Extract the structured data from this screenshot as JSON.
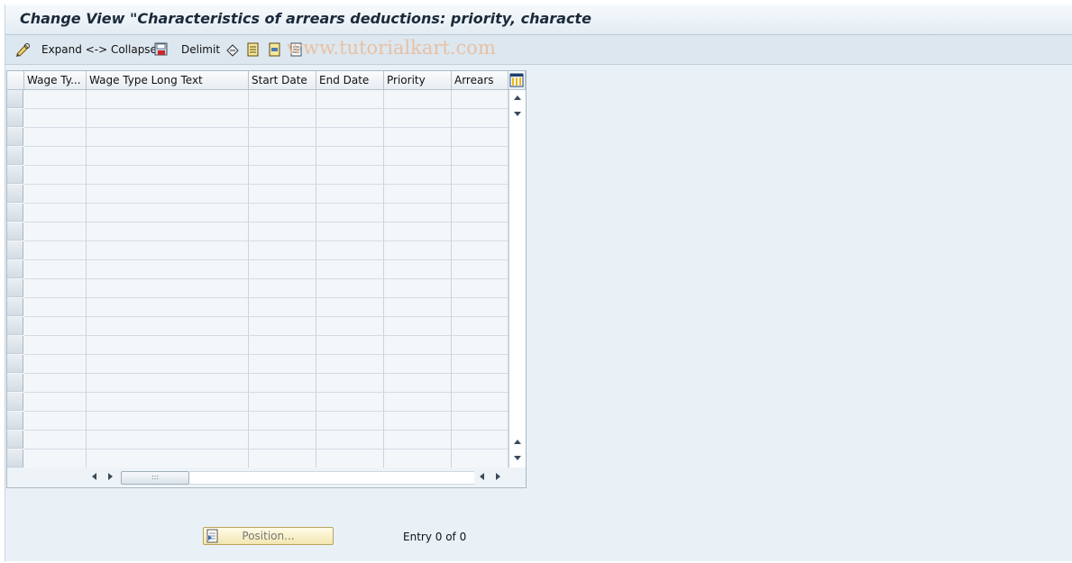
{
  "window": {
    "title": "Change View \"Characteristics of arrears deductions: priority, characte"
  },
  "toolbar": {
    "expand_collapse_label": "Expand <-> Collapse",
    "delimit_label": "Delimit",
    "watermark": "www.tutorialkart.com"
  },
  "table": {
    "columns": [
      {
        "label": "Wage Ty..."
      },
      {
        "label": "Wage Type Long Text"
      },
      {
        "label": "Start Date"
      },
      {
        "label": "End Date"
      },
      {
        "label": "Priority"
      },
      {
        "label": "Arrears"
      }
    ],
    "rows": []
  },
  "footer": {
    "position_button_label": "Position...",
    "entry_text": "Entry 0 of 0"
  },
  "colors": {
    "background": "#eaf1f6",
    "title_text": "#1b2a3a",
    "position_button": "#f3e6b1"
  }
}
